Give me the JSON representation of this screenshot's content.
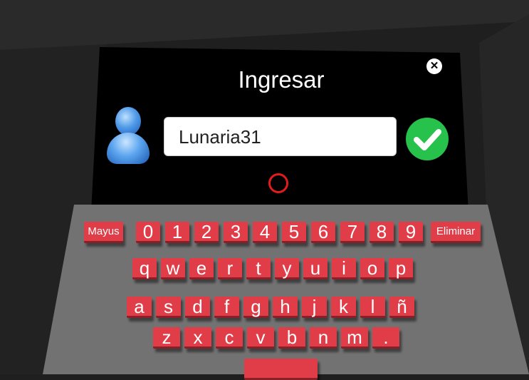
{
  "dialog": {
    "title": "Ingresar",
    "username_value": "Lunaria31",
    "close_symbol": "✕",
    "confirm_icon": "check-icon",
    "user_icon": "user-avatar-icon",
    "loading_icon": "loading-ring-icon"
  },
  "keyboard": {
    "row1": [
      "Mayus",
      "0",
      "1",
      "2",
      "3",
      "4",
      "5",
      "6",
      "7",
      "8",
      "9",
      "Eliminar"
    ],
    "row2": [
      "q",
      "w",
      "e",
      "r",
      "t",
      "y",
      "u",
      "i",
      "o",
      "p"
    ],
    "row3": [
      "a",
      "s",
      "d",
      "f",
      "g",
      "h",
      "j",
      "k",
      "l",
      "ñ"
    ],
    "row4": [
      "z",
      "x",
      "c",
      "v",
      "b",
      "n",
      "m",
      "."
    ],
    "space_label": ""
  },
  "colors": {
    "key": "#e03d48",
    "confirm": "#27c24c",
    "panel": "#000000",
    "loader": "#e21b1b"
  }
}
